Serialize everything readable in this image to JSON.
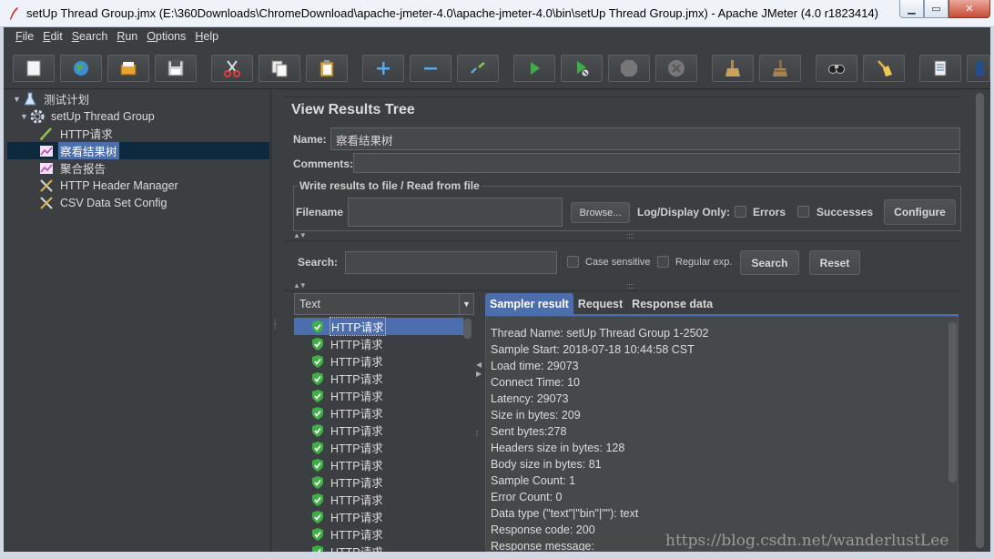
{
  "window": {
    "title": "setUp Thread Group.jmx (E:\\360Downloads\\ChromeDownload\\apache-jmeter-4.0\\apache-jmeter-4.0\\bin\\setUp Thread Group.jmx) - Apache JMeter (4.0 r1823414)",
    "min": "▁",
    "max": "▭",
    "close": "✕"
  },
  "menu": [
    {
      "key": "F",
      "rest": "ile"
    },
    {
      "key": "E",
      "rest": "dit"
    },
    {
      "key": "S",
      "rest": "earch"
    },
    {
      "key": "R",
      "rest": "un"
    },
    {
      "key": "O",
      "rest": "ptions"
    },
    {
      "key": "H",
      "rest": "elp"
    }
  ],
  "toolbar_icons": [
    "new-icon",
    "templates-icon",
    "open-icon",
    "save-icon",
    "cut-icon",
    "copy-icon",
    "paste-icon",
    "expand-icon",
    "collapse-icon",
    "toggle-icon",
    "start-icon",
    "start-no-pause-icon",
    "stop-icon",
    "shutdown-icon",
    "clear-icon",
    "clear-all-icon",
    "search-icon",
    "reset-search-icon",
    "function-helper-icon",
    "help-icon"
  ],
  "tree": {
    "items": [
      {
        "label": "测试计划",
        "toggle": "▼",
        "icon": "test-plan-icon"
      },
      {
        "label": "setUp Thread Group",
        "toggle": "▼",
        "icon": "thread-group-gear-icon"
      },
      {
        "label": "HTTP请求",
        "toggle": "",
        "icon": "http-sampler-pen-icon"
      },
      {
        "label": "察看结果树",
        "toggle": "",
        "icon": "listener-graph-icon"
      },
      {
        "label": "聚合报告",
        "toggle": "",
        "icon": "listener-graph-icon"
      },
      {
        "label": "HTTP Header Manager",
        "toggle": "",
        "icon": "config-wrench-icon"
      },
      {
        "label": "CSV Data Set Config",
        "toggle": "",
        "icon": "config-wrench-icon"
      }
    ]
  },
  "panel": {
    "title": "View Results Tree",
    "name_label": "Name:",
    "name_value": "察看结果树",
    "comments_label": "Comments:",
    "write_legend": "Write results to file / Read from file",
    "filename_label": "Filename",
    "browse_label": "Browse...",
    "log_display_label": "Log/Display Only:",
    "errors_label": "Errors",
    "successes_label": "Successes",
    "configure_label": "Configure",
    "search_label": "Search:",
    "case_sensitive_label": "Case sensitive",
    "regex_label": "Regular exp.",
    "search_button": "Search",
    "reset_button": "Reset"
  },
  "results": {
    "renderer": "Text",
    "items": [
      "HTTP请求",
      "HTTP请求",
      "HTTP请求",
      "HTTP请求",
      "HTTP请求",
      "HTTP请求",
      "HTTP请求",
      "HTTP请求",
      "HTTP请求",
      "HTTP请求",
      "HTTP请求",
      "HTTP请求",
      "HTTP请求",
      "HTTP请求"
    ]
  },
  "tabs": [
    "Sampler result",
    "Request",
    "Response data"
  ],
  "sampler_result": [
    "Thread Name: setUp Thread Group 1-2502",
    "Sample Start: 2018-07-18 10:44:58 CST",
    "Load time: 29073",
    "Connect Time: 10",
    "Latency: 29073",
    "Size in bytes: 209",
    "Sent bytes:278",
    "Headers size in bytes: 128",
    "Body size in bytes: 81",
    "Sample Count: 1",
    "Error Count: 0",
    "Data type (\"text\"|\"bin\"|\"\"): text",
    "Response code: 200",
    "Response message: "
  ],
  "watermark": "https://blog.csdn.net/wanderlustLee",
  "colors": {
    "selection": "#4b6eaf",
    "background": "#3c3f41",
    "success": "#3cb043"
  }
}
